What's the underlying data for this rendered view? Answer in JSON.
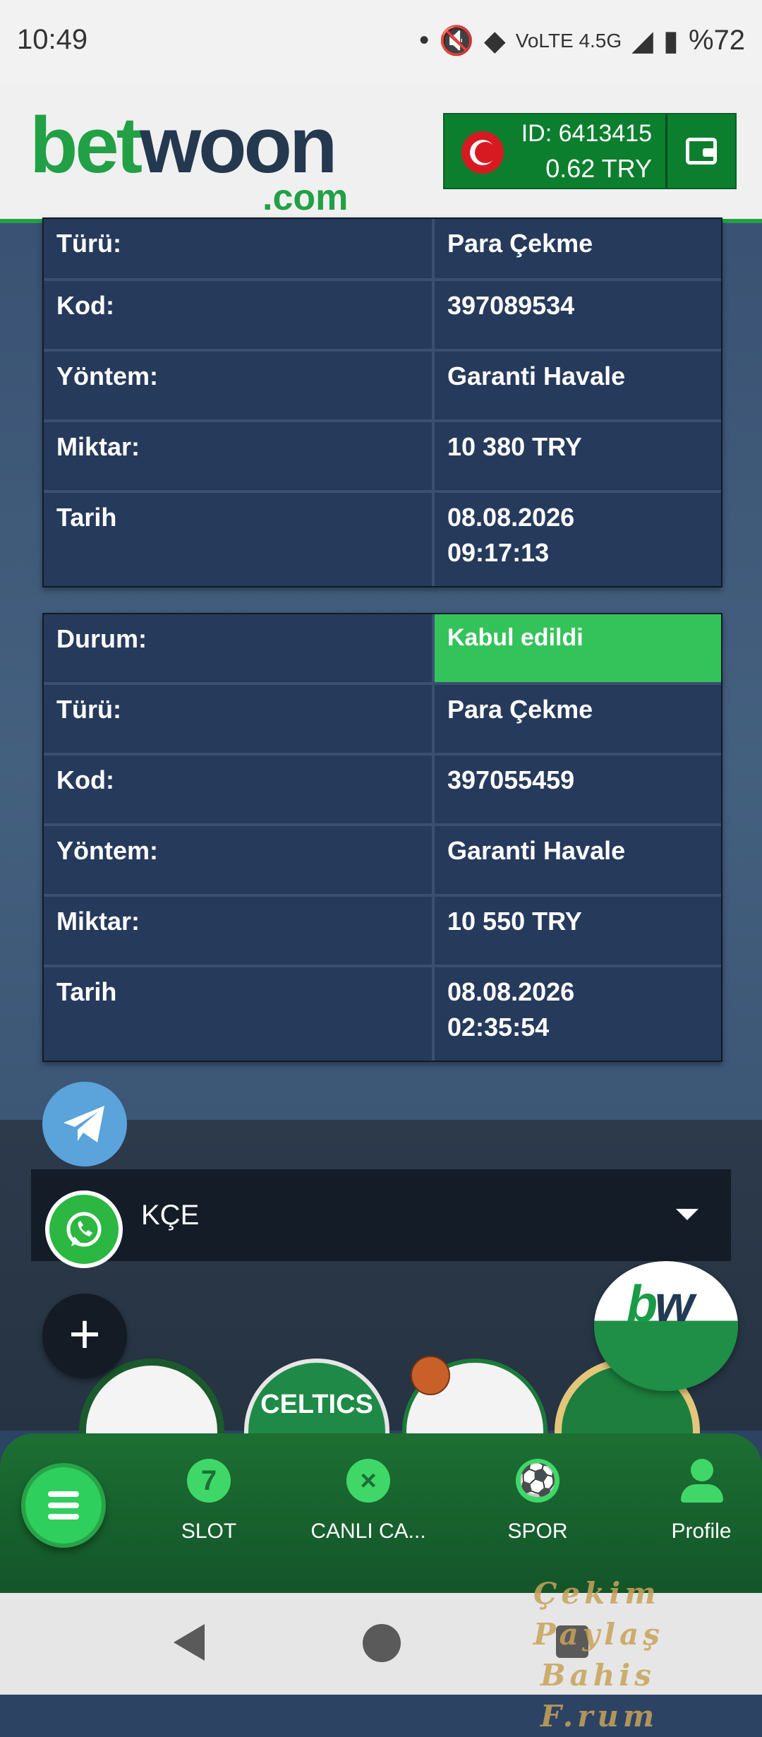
{
  "status_bar": {
    "time": "10:49",
    "dot": "•",
    "network": "VoLTE 4.5G",
    "battery": "%72"
  },
  "header": {
    "logo_bet": "bet",
    "logo_woon": "woon",
    "logo_com": ".com",
    "account_id": "ID: 6413415",
    "balance": "0.62   TRY",
    "flag": "turkey-flag-icon",
    "wallet_icon": "wallet-icon"
  },
  "transactions": [
    {
      "rows": [
        {
          "label": "Türü:",
          "value": "Para Çekme"
        },
        {
          "label": "Kod:",
          "value": "397089534"
        },
        {
          "label": "Yöntem:",
          "value": "Garanti Havale"
        },
        {
          "label": "Miktar:",
          "value": "10 380 TRY"
        },
        {
          "label": "Tarih",
          "value_line1": "08.08.2026",
          "value_line2": "09:17:13"
        }
      ]
    },
    {
      "rows": [
        {
          "label": "Durum:",
          "value": "Kabul edildi"
        },
        {
          "label": "Türü:",
          "value": "Para Çekme"
        },
        {
          "label": "Kod:",
          "value": "397055459"
        },
        {
          "label": "Yöntem:",
          "value": "Garanti Havale"
        },
        {
          "label": "Miktar:",
          "value": "10 550 TRY"
        },
        {
          "label": "Tarih",
          "value_line1": "08.08.2026",
          "value_line2": "02:35:54"
        }
      ]
    }
  ],
  "colors": {
    "accepted": "#34c35a",
    "brand_green": "#22a046",
    "card_cell": "#263a5c"
  },
  "language_select": {
    "value": "KÇE"
  },
  "fabs": {
    "telegram": "telegram-icon",
    "whatsapp": "whatsapp-icon",
    "plus": "+",
    "bw_b": "b",
    "bw_w": "w"
  },
  "badges": {
    "celtics": "CELTICS"
  },
  "bottom_nav": {
    "menu": "menu-icon",
    "items": [
      {
        "label": "SLOT",
        "icon": "slot-7-icon",
        "glyph": "7"
      },
      {
        "label": "CANLI CA...",
        "icon": "live-casino-chip-icon",
        "glyph": "×"
      },
      {
        "label": "SPOR",
        "icon": "soccer-ball-icon",
        "glyph": "⚽"
      },
      {
        "label": "Profile",
        "icon": "profile-icon"
      }
    ]
  },
  "watermark": {
    "line1": "Çekim Paylaş",
    "line2": "Bahis F.rum"
  }
}
